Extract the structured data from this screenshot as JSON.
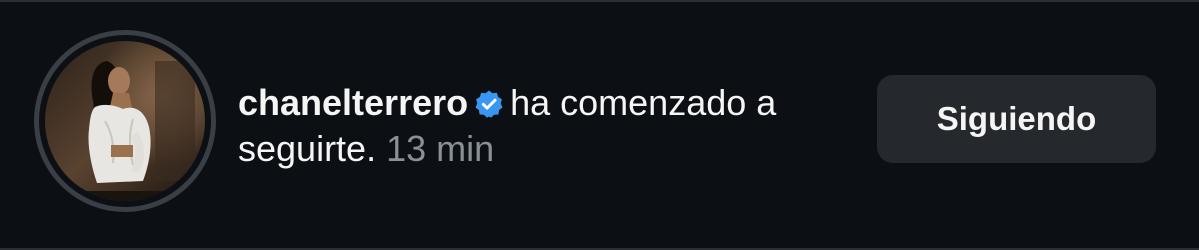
{
  "notification": {
    "avatar_icon": "profile-photo",
    "username": "chanelterrero",
    "verified_icon": "verified-badge-icon",
    "verified_color": "#3897f0",
    "message_part1": "ha comenzado a",
    "message_part2": "seguirte.",
    "time": "13 min"
  },
  "follow_button": {
    "label": "Siguiendo",
    "background": "#25292e"
  }
}
